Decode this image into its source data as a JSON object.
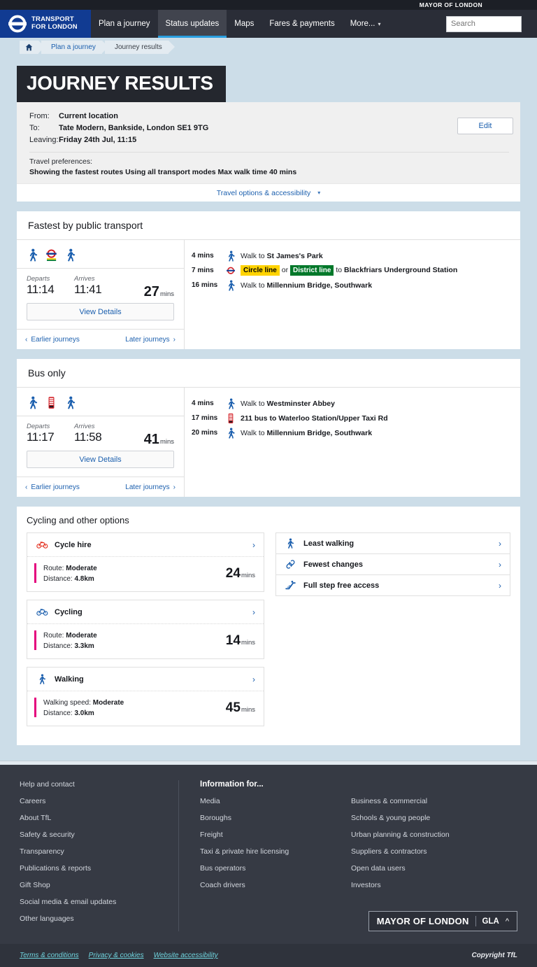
{
  "topbar": {
    "mayor_text": "MAYOR OF LONDON"
  },
  "nav": {
    "logo_line1": "TRANSPORT",
    "logo_line2": "FOR LONDON",
    "items": [
      {
        "label": "Plan a journey",
        "active": false
      },
      {
        "label": "Status updates",
        "active": true
      },
      {
        "label": "Maps",
        "active": false
      },
      {
        "label": "Fares & payments",
        "active": false
      },
      {
        "label": "More...",
        "active": false,
        "caret": true
      }
    ],
    "search_placeholder": "Search",
    "search_value": ""
  },
  "breadcrumb": {
    "home_label": "Home",
    "items": [
      {
        "label": "Plan a journey",
        "current": false
      },
      {
        "label": "Journey results",
        "current": true
      }
    ]
  },
  "page_title": "JOURNEY RESULTS",
  "summary": {
    "from_label": "From:",
    "from_value": "Current location",
    "to_label": "To:",
    "to_value": "Tate Modern, Bankside, London SE1 9TG",
    "leaving_label": "Leaving:",
    "leaving_value": "Friday 24th Jul, 11:15",
    "prefs_label": "Travel preferences:",
    "prefs_value": "Showing the fastest routes  Using all transport modes  Max walk time 40 mins",
    "edit_label": "Edit",
    "travel_options_label": "Travel options & accessibility"
  },
  "results": [
    {
      "title": "Fastest by public transport",
      "mode_icons": [
        "walk-icon",
        "underground-roundel-icon",
        "walk-icon"
      ],
      "departs_label": "Departs",
      "arrives_label": "Arrives",
      "departs": "11:14",
      "arrives": "11:41",
      "duration": "27",
      "duration_unit": "mins",
      "details_label": "View Details",
      "earlier_label": "Earlier journeys",
      "later_label": "Later journeys",
      "legs": [
        {
          "time": "4 mins",
          "icon": "walk-icon",
          "prefix": "Walk to ",
          "destination": "St James's Park"
        },
        {
          "time": "7 mins",
          "icon": "underground-roundel-icon",
          "badges": [
            {
              "text": "Circle line",
              "bg": "#FFD300",
              "fg": "#000000"
            },
            {
              "text": "District line",
              "bg": "#00782A",
              "fg": "#FFFFFF"
            }
          ],
          "separator": " or ",
          "suffix_prefix": " to ",
          "destination": "Blackfriars Underground Station"
        },
        {
          "time": "16 mins",
          "icon": "walk-icon",
          "prefix": "Walk to ",
          "destination": "Millennium Bridge, Southwark"
        }
      ]
    },
    {
      "title": "Bus only",
      "mode_icons": [
        "walk-icon",
        "bus-icon",
        "walk-icon"
      ],
      "departs_label": "Departs",
      "arrives_label": "Arrives",
      "departs": "11:17",
      "arrives": "11:58",
      "duration": "41",
      "duration_unit": "mins",
      "details_label": "View Details",
      "earlier_label": "Earlier journeys",
      "later_label": "Later journeys",
      "legs": [
        {
          "time": "4 mins",
          "icon": "walk-icon",
          "prefix": "Walk to ",
          "destination": "Westminster Abbey"
        },
        {
          "time": "17 mins",
          "icon": "bus-icon",
          "prefix": "",
          "destination": "211 bus to Waterloo Station/Upper Taxi Rd"
        },
        {
          "time": "20 mins",
          "icon": "walk-icon",
          "prefix": "Walk to ",
          "destination": "Millennium Bridge, Southwark"
        }
      ]
    }
  ],
  "other_options": {
    "title": "Cycling and other options",
    "accent_color": "#e4007d",
    "cards": [
      {
        "icon": "cycle-hire-icon",
        "icon_color": "#e32f1e",
        "name": "Cycle hire",
        "meta_line1_label": "Route: ",
        "meta_line1_value": "Moderate",
        "meta_line2_label": "Distance: ",
        "meta_line2_value": "4.8km",
        "duration": "24",
        "duration_unit": "mins"
      },
      {
        "icon": "cycling-icon",
        "icon_color": "#1b5fae",
        "name": "Cycling",
        "meta_line1_label": "Route: ",
        "meta_line1_value": "Moderate",
        "meta_line2_label": "Distance: ",
        "meta_line2_value": "3.3km",
        "duration": "14",
        "duration_unit": "mins"
      },
      {
        "icon": "walk-icon",
        "icon_color": "#1b5fae",
        "name": "Walking",
        "meta_line1_label": "Walking speed: ",
        "meta_line1_value": "Moderate",
        "meta_line2_label": "Distance: ",
        "meta_line2_value": "3.0km",
        "duration": "45",
        "duration_unit": "mins"
      }
    ],
    "filters": [
      {
        "icon": "walk-icon",
        "label": "Least walking"
      },
      {
        "icon": "link-changes-icon",
        "label": "Fewest changes"
      },
      {
        "icon": "escalator-icon",
        "label": "Full step free access"
      }
    ]
  },
  "footer": {
    "col1": [
      "Help and contact",
      "Careers",
      "About TfL",
      "Safety & security",
      "Transparency",
      "Publications & reports",
      "Gift Shop",
      "Social media & email updates",
      "Other languages"
    ],
    "col2_head": "Information for...",
    "col2": [
      "Media",
      "Boroughs",
      "Freight",
      "Taxi & private hire licensing",
      "Bus operators",
      "Coach drivers"
    ],
    "col3": [
      "Business & commercial",
      "Schools & young people",
      "Urban planning & construction",
      "Suppliers & contractors",
      "Open data users",
      "Investors"
    ],
    "gla_main": "MAYOR OF LONDON",
    "gla_sub": "GLA",
    "legal_links": [
      "Terms & conditions",
      "Privacy & cookies",
      "Website accessibility"
    ],
    "copyright": "Copyright TfL"
  }
}
